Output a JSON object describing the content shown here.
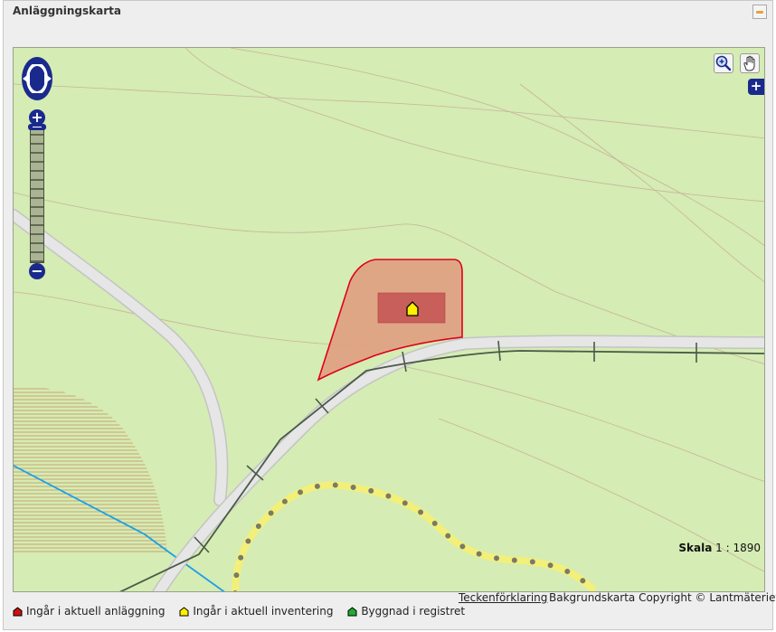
{
  "panel": {
    "title": "Anläggningskarta"
  },
  "map": {
    "scale_label": "Skala",
    "scale_value": "1 : 1890",
    "tools": {
      "zoom_box": "zoom-box-tool",
      "pan": "pan-hand-tool"
    },
    "controls": {
      "zoom_in": "+",
      "zoom_out": "−",
      "layer_switcher": "+"
    },
    "colors": {
      "background": "#d5ecb4",
      "road": "#e2e2e2",
      "facility_fill": "#e0a082",
      "facility_border": "#e0001a",
      "building": "#c95f5a",
      "water": "#1a9fe8",
      "trail": "#f2f07a",
      "marker": "#ffef00"
    }
  },
  "footer": {
    "legend_link": "Teckenförklaring",
    "copyright": "Bakgrundskarta Copyright © Lantmäteriet"
  },
  "legend": [
    {
      "label": "Ingår i aktuell anläggning",
      "color": "#cc1111"
    },
    {
      "label": "Ingår i aktuell inventering",
      "color": "#ffef00"
    },
    {
      "label": "Byggnad i registret",
      "color": "#22aa33"
    }
  ]
}
